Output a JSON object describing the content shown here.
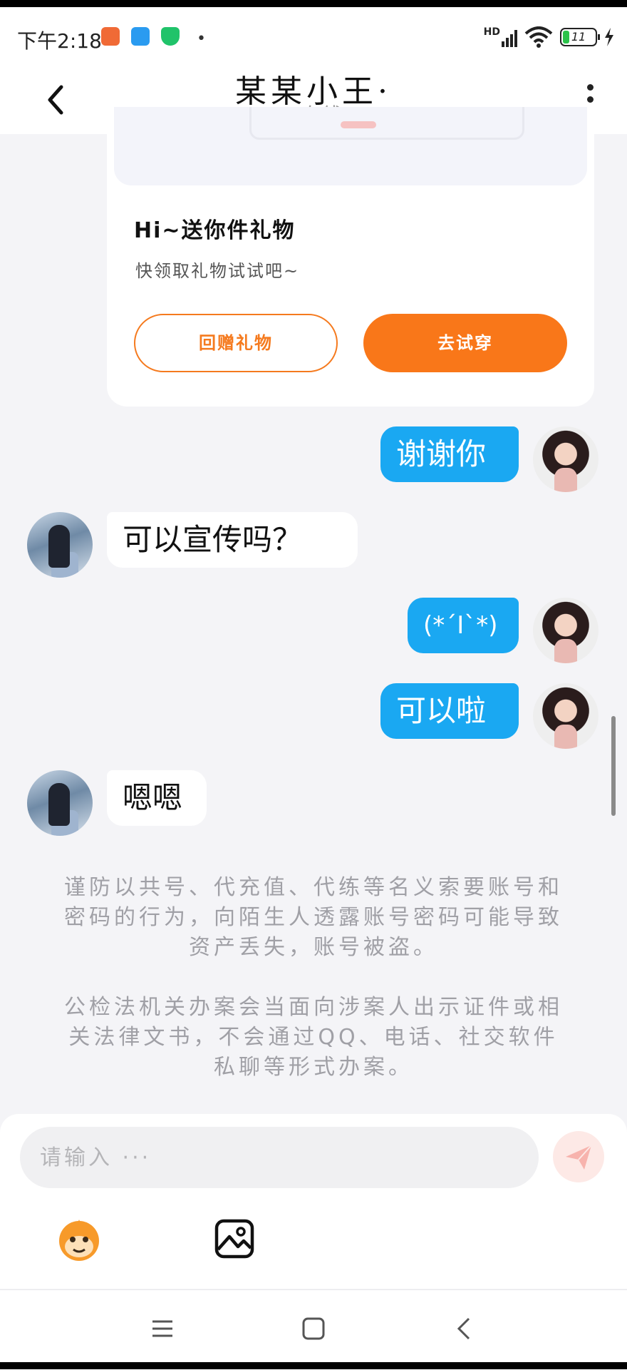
{
  "status_bar": {
    "time": "下午2:18",
    "network": "HD",
    "battery": "11"
  },
  "header": {
    "title": "某某小王·",
    "status": "在线"
  },
  "gift_card": {
    "title": "Hi~送你件礼物",
    "subtitle": "快领取礼物试试吧~",
    "return_button": "回赠礼物",
    "try_button": "去试穿"
  },
  "messages": [
    {
      "from": "me",
      "text": "谢谢你"
    },
    {
      "from": "other",
      "text": "可以宣传吗？"
    },
    {
      "from": "me",
      "text": "(*´I`*)"
    },
    {
      "from": "me",
      "text": "可以啦"
    },
    {
      "from": "other",
      "text": "嗯嗯"
    }
  ],
  "notices": [
    "谨防以共号、代充值、代练等名义索要账号和密码的行为，向陌生人透露账号密码可能导致资产丢失，账号被盗。",
    "公检法机关办案会当面向涉案人出示证件或相关法律文书，不会通过QQ、电话、社交软件私聊等形式办案。"
  ],
  "input": {
    "placeholder": "请输入 ···"
  },
  "colors": {
    "accent_orange": "#f97719",
    "bubble_blue": "#1aa8f2",
    "online_green": "#2bc24a"
  },
  "icons": {
    "back": "chevron-left-icon",
    "more": "more-vertical-icon",
    "send": "send-icon",
    "emoji": "monkey-emoji-icon",
    "image": "image-icon"
  }
}
